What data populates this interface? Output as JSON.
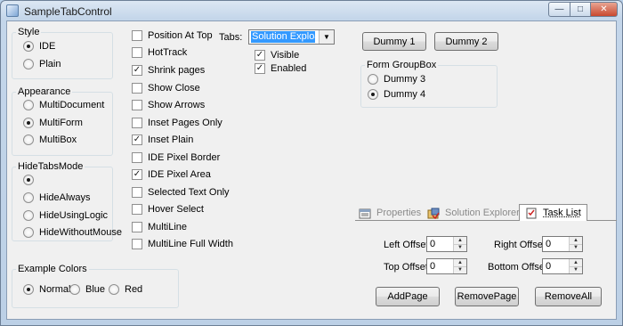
{
  "window": {
    "title": "SampleTabControl",
    "min": "—",
    "max": "□",
    "close": "✕"
  },
  "style_group": {
    "legend": "Style",
    "options": [
      "IDE",
      "Plain"
    ],
    "selected": 0
  },
  "appearance_group": {
    "legend": "Appearance",
    "options": [
      "MultiDocument",
      "MultiForm",
      "MultiBox"
    ],
    "selected": 1
  },
  "hidetabs_group": {
    "legend": "HideTabsMode",
    "options": [
      "",
      "HideAlways",
      "HideUsingLogic",
      "HideWithoutMouse"
    ],
    "selected": 0
  },
  "colors_group": {
    "legend": "Example Colors",
    "options": [
      "Normal",
      "Blue",
      "Red"
    ],
    "selected": 0
  },
  "options": [
    {
      "label": "Position At Top",
      "checked": false
    },
    {
      "label": "HotTrack",
      "checked": false
    },
    {
      "label": "Shrink pages",
      "checked": true
    },
    {
      "label": "Show Close",
      "checked": false
    },
    {
      "label": "Show Arrows",
      "checked": false
    },
    {
      "label": "Inset Pages Only",
      "checked": false
    },
    {
      "label": "Inset Plain",
      "checked": true
    },
    {
      "label": "IDE Pixel Border",
      "checked": false
    },
    {
      "label": "IDE Pixel Area",
      "checked": true
    },
    {
      "label": "Selected Text Only",
      "checked": false
    },
    {
      "label": "Hover Select",
      "checked": false
    },
    {
      "label": "MultiLine",
      "checked": false
    },
    {
      "label": "MultiLine Full Width",
      "checked": false
    }
  ],
  "tabs_select": {
    "label": "Tabs:",
    "value": "Solution Explo&rer"
  },
  "visible": {
    "label": "Visible",
    "checked": true
  },
  "enabled": {
    "label": "Enabled",
    "checked": true
  },
  "dummy_buttons": [
    "Dummy 1",
    "Dummy 2"
  ],
  "form_group": {
    "legend": "Form GroupBox",
    "options": [
      "Dummy 3",
      "Dummy 4"
    ],
    "selected": 1
  },
  "tab_control": {
    "tabs": [
      {
        "label": "Properties",
        "icon": "properties-icon"
      },
      {
        "label": "Solution Explorer",
        "icon": "solution-explorer-icon"
      },
      {
        "label": "Task List",
        "icon": "task-list-icon"
      }
    ],
    "active": 2
  },
  "offsets": {
    "left": {
      "label": "Left Offset",
      "value": "0"
    },
    "right": {
      "label": "Right Offset",
      "value": "0"
    },
    "top": {
      "label": "Top Offset",
      "value": "0"
    },
    "bottom": {
      "label": "Bottom Offset",
      "value": "0"
    }
  },
  "page_buttons": [
    "AddPage",
    "RemovePage",
    "RemoveAll"
  ]
}
